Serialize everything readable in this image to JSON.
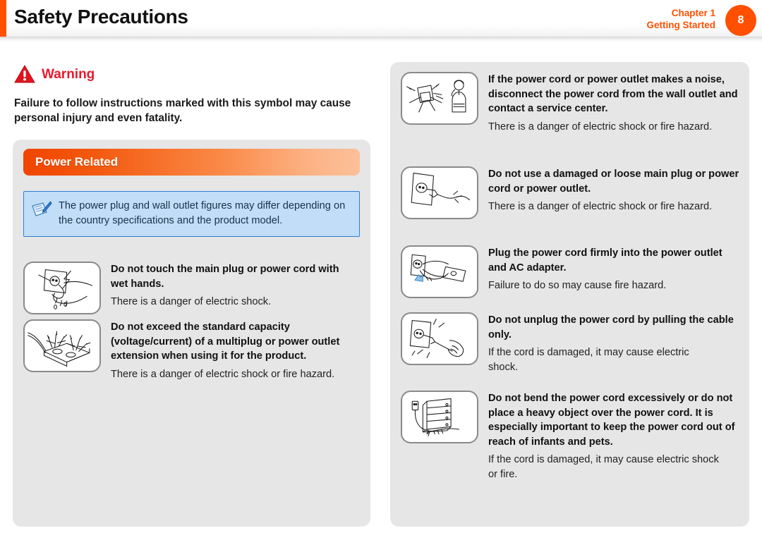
{
  "header": {
    "title": "Safety Precautions",
    "chapter_line1": "Chapter 1",
    "chapter_line2": "Getting Started",
    "page_number": "8",
    "accent_color": "#ff5000",
    "badge_color": "#ff4f00"
  },
  "warning": {
    "icon": "warning-triangle-icon",
    "label": "Warning",
    "label_color": "#e8192c",
    "description": "Failure to follow instructions marked with this symbol may cause personal injury and even fatality."
  },
  "section": {
    "banner_title": "Power Related",
    "banner_gradient_from": "#f04500",
    "banner_gradient_to": "#fcc09a"
  },
  "note": {
    "icon": "note-pen-icon",
    "text": "The power plug and wall outlet figures may differ depending on the country specifications and the product model.",
    "border_color": "#2f7fd4",
    "background_color": "#c2ddf7"
  },
  "left_column": {
    "items": [
      {
        "icon": "wet-hands-plug-icon",
        "title": "Do not touch the main plug or power cord with wet hands.",
        "description": "There is a danger of electric shock."
      },
      {
        "icon": "overloaded-multiplug-icon",
        "title": "Do not exceed the standard capacity (voltage/current) of a multiplug or power outlet extension when using it for the product.",
        "description": "There is a danger of electric shock or fire hazard."
      }
    ]
  },
  "right_column": {
    "items": [
      {
        "icon": "noisy-outlet-service-call-icon",
        "title": "If the power cord or power outlet makes a noise, disconnect the power cord from the wall outlet and contact a service center.",
        "description": "There is a danger of electric shock or fire hazard."
      },
      {
        "icon": "damaged-loose-plug-icon",
        "title": "Do not use a damaged or loose main plug or power cord or power outlet.",
        "description": "There is a danger of electric shock or fire hazard."
      },
      {
        "icon": "plug-firmly-ac-adapter-icon",
        "title": "Plug the power cord firmly into the power outlet and AC adapter.",
        "description": "Failure to do so may cause fire hazard."
      },
      {
        "icon": "pulling-cable-unplug-icon",
        "title": "Do not unplug the power cord by pulling the cable only.",
        "description": "If the cord is damaged, it may cause electric shock."
      },
      {
        "icon": "bent-cord-heavy-object-icon",
        "title": "Do not bend the power cord excessively or do not place a heavy object over the power cord. It is especially important to keep the power cord out of reach of infants and pets.",
        "description": "If the cord is damaged, it may cause electric shock or fire."
      }
    ]
  }
}
